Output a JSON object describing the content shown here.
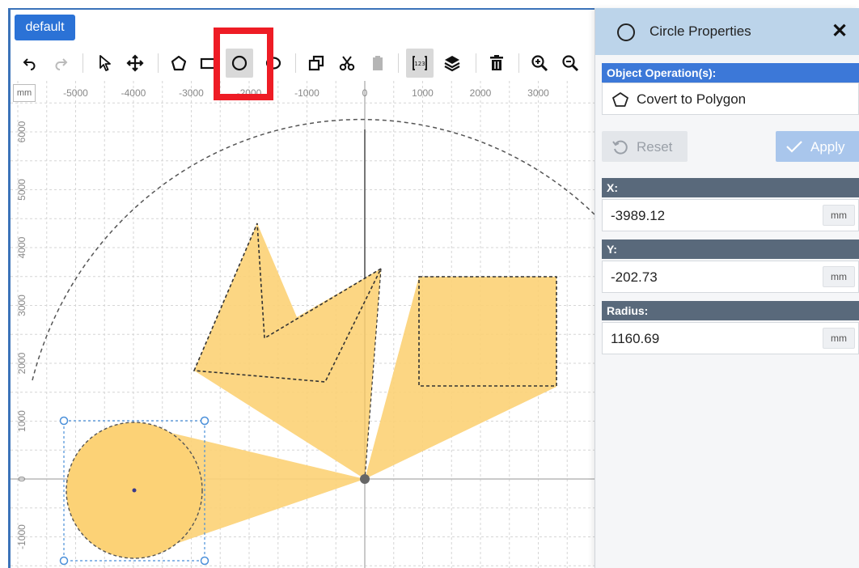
{
  "layer_tag": "default",
  "toolbar": {
    "items": [
      {
        "name": "undo",
        "icon": "undo-icon"
      },
      {
        "name": "redo",
        "icon": "redo-icon"
      },
      {
        "name": "select",
        "icon": "pointer-icon"
      },
      {
        "name": "move",
        "icon": "move-icon"
      },
      {
        "name": "polygon",
        "icon": "polygon-icon"
      },
      {
        "name": "rectangle",
        "icon": "rectangle-icon"
      },
      {
        "name": "circle",
        "icon": "circle-icon",
        "active": true
      },
      {
        "name": "ellipse",
        "icon": "ellipse-icon"
      },
      {
        "name": "copy",
        "icon": "copy-icon"
      },
      {
        "name": "cut",
        "icon": "scissors-icon"
      },
      {
        "name": "paste",
        "icon": "clipboard-icon"
      },
      {
        "name": "coordinates",
        "icon": "coordinates-icon",
        "active": true
      },
      {
        "name": "layers",
        "icon": "layers-icon"
      },
      {
        "name": "delete",
        "icon": "trash-icon"
      },
      {
        "name": "zoom-in",
        "icon": "zoom-in-icon"
      },
      {
        "name": "zoom-out",
        "icon": "zoom-out-icon"
      }
    ]
  },
  "canvas": {
    "unit": "mm",
    "x_ticks": [
      "-5000",
      "-4000",
      "-3000",
      "-2000",
      "-1000",
      "0",
      "1000",
      "2000",
      "3000"
    ],
    "y_ticks": [
      "6000",
      "5000",
      "4000",
      "3000",
      "2000",
      "1000",
      "0",
      "-1000"
    ],
    "colors": {
      "shape_fill": "#fcd276",
      "grid": "#d6d6d6",
      "axis": "#b8b8b8",
      "selection": "#4a8fd9"
    },
    "shapes": {
      "selected_circle": {
        "x": -3989.12,
        "y": -202.73,
        "radius": 1160.69
      }
    }
  },
  "panel": {
    "title": "Circle Properties",
    "close_label": "✕",
    "operations_header": "Object Operation(s):",
    "convert_label": "Covert to Polygon",
    "reset_label": "Reset",
    "apply_label": "Apply",
    "fields": [
      {
        "label": "X:",
        "value": "-3989.12",
        "unit": "mm"
      },
      {
        "label": "Y:",
        "value": "-202.73",
        "unit": "mm"
      },
      {
        "label": "Radius:",
        "value": "1160.69",
        "unit": "mm"
      }
    ]
  }
}
